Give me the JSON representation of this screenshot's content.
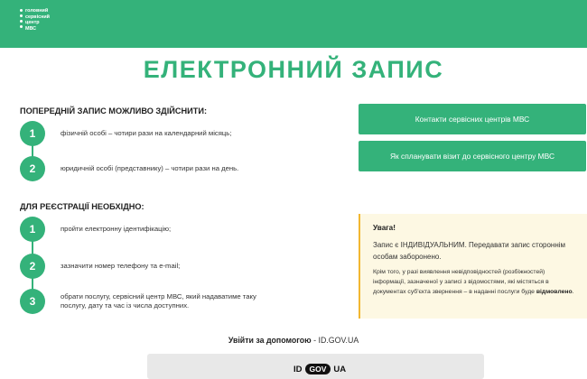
{
  "header": {
    "logo_lines": [
      "головний",
      "сервісний",
      "центр",
      "МВС"
    ]
  },
  "title": "ЕЛЕКТРОННИЙ ЗАПИС",
  "booking": {
    "heading": "ПОПЕРЕДНІЙ ЗАПИС МОЖЛИВО ЗДІЙСНИТИ:",
    "items": [
      {
        "num": "1",
        "text": "фізичній особі – чотири рази на календарний місяць;"
      },
      {
        "num": "2",
        "text": "юридичній особі (представнику) – чотири рази на день."
      }
    ]
  },
  "registration": {
    "heading": "ДЛЯ РЕЄСТРАЦІЇ НЕОБХІДНО:",
    "items": [
      {
        "num": "1",
        "text": "пройти електронну ідентифікацію;"
      },
      {
        "num": "2",
        "text": "зазначити номер телефону та e-mail;"
      },
      {
        "num": "3",
        "text": "обрати послугу, сервісний центр МВС, який надаватиме таку послугу, дату та час із числа доступних."
      }
    ]
  },
  "buttons": {
    "contacts": "Контакти сервісних центрів МВС",
    "plan_visit": "Як спланувати візит до сервісного центру МВС"
  },
  "warning": {
    "title": "Увага!",
    "text1": "Запис є ІНДИВІДУАЛЬНИМ. Передавати запис стороннім особам заборонено.",
    "text2_prefix": "Крім того, у разі виявлення невідповідностей (розбіжностей) інформації, зазначеної у записі з відомостями, які містяться в документах суб'єкта звернення – в наданні послуги буде ",
    "text2_bold": "відмовлено",
    "text2_suffix": "."
  },
  "login": {
    "label": "Увійти за допомогою",
    "separator": " - ",
    "service": "ID.GOV.UA"
  },
  "id_logo": {
    "part1": "ID",
    "part2": "GOV",
    "part3": "UA"
  },
  "colors": {
    "brand_green": "#34b27a",
    "warning_bg": "#fdf8e3",
    "warning_border": "#f2b731"
  }
}
